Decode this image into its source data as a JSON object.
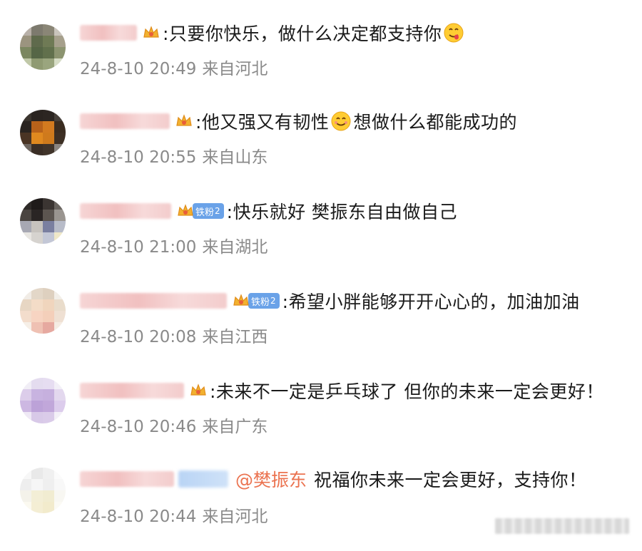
{
  "colors": {
    "text": "#1a1a1a",
    "meta": "#8a8a8a",
    "mention": "#eb7350",
    "fan_badge": "#6aa2e8"
  },
  "comments": [
    {
      "text": ":只要你快乐，做什么决定都支持你",
      "emoji_after": "yum-face-emoji",
      "date": "24-8-10 20:49",
      "location": "来自河北"
    },
    {
      "text_before": ":他又强又有韧性",
      "emoji_mid": "smiling-face-emoji",
      "text_after": "想做什么都能成功的",
      "date": "24-8-10 20:55",
      "location": "来自山东"
    },
    {
      "fan_badge": {
        "label": "铁粉",
        "level": "2"
      },
      "text": ":快乐就好 樊振东自由做自己",
      "date": "24-8-10 21:00",
      "location": "来自湖北"
    },
    {
      "fan_badge": {
        "label": "铁粉",
        "level": "2"
      },
      "text": ":希望小胖能够开开心心的，加油加油",
      "date": "24-8-10 20:08",
      "location": "来自江西"
    },
    {
      "text": ":未来不一定是乒乓球了 但你的未来一定会更好！",
      "date": "24-8-10 20:46",
      "location": "来自广东"
    },
    {
      "mention": "@樊振东",
      "text": "祝福你未来一定会更好，支持你！",
      "date": "24-8-10 20:44",
      "location": "来自河北"
    }
  ]
}
